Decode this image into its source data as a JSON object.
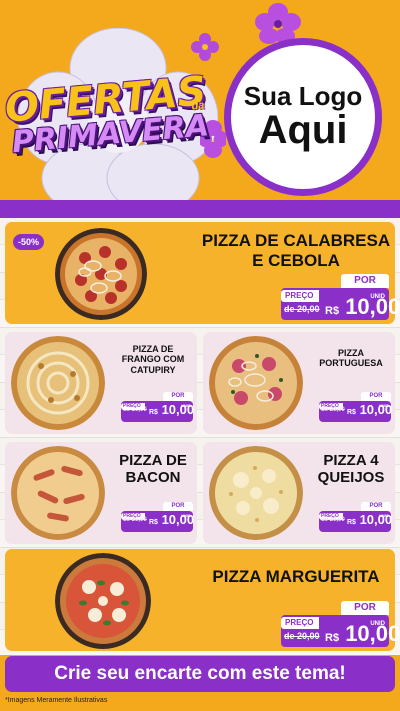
{
  "header": {
    "offer_line1": "OFERTAS",
    "offer_da": "da",
    "offer_line2": "PRIMAVERA",
    "logo_line1": "Sua Logo",
    "logo_line2": "Aqui"
  },
  "colors": {
    "orange": "#f4a81c",
    "purple": "#8a2fc7",
    "card_orange": "#f6b22a",
    "card_pink": "#f3e3ea"
  },
  "items": [
    {
      "name": "PIZZA DE CALABRESA E CEBOLA",
      "badge": "-50%",
      "por": "POR",
      "preco": "PREÇO",
      "de": "de 20,00",
      "currency": "R$",
      "value": "10,00",
      "unid": "UNID"
    },
    {
      "name": "PIZZA DE FRANGO COM CATUPIRY",
      "por": "POR",
      "preco": "PREÇO",
      "de": "de 20,00",
      "currency": "R$",
      "value": "10,00",
      "unid": "UNID"
    },
    {
      "name": "PIZZA PORTUGUESA",
      "por": "POR",
      "preco": "PREÇO",
      "de": "de 20,00",
      "currency": "R$",
      "value": "10,00",
      "unid": "UNID"
    },
    {
      "name": "PIZZA DE BACON",
      "por": "POR",
      "preco": "PREÇO",
      "de": "de 20,00",
      "currency": "R$",
      "value": "10,00",
      "unid": "UNID"
    },
    {
      "name": "PIZZA 4 QUEIJOS",
      "por": "POR",
      "preco": "PREÇO",
      "de": "de 20,00",
      "currency": "R$",
      "value": "10,00",
      "unid": "UNID"
    },
    {
      "name": "PIZZA MARGUERITA",
      "por": "POR",
      "preco": "PREÇO",
      "de": "de 20,00",
      "currency": "R$",
      "value": "10,00",
      "unid": "UNID"
    }
  ],
  "footer": {
    "cta": "Crie seu encarte com este tema!",
    "disclaimer": "*Imagens Meramente Ilustrativas"
  }
}
